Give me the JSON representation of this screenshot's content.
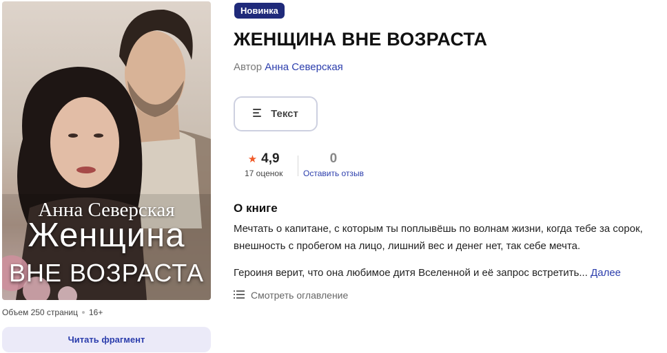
{
  "cover": {
    "author_text": "Анна Северская",
    "title_line1": "Женщина",
    "title_line2": "ВНЕ ВОЗРАСТА"
  },
  "meta": {
    "volume": "Объем 250 страниц",
    "age": "16+"
  },
  "read_fragment_label": "Читать фрагмент",
  "badge_label": "Новинка",
  "book_title": "ЖЕНЩИНА ВНЕ ВОЗРАСТА",
  "author": {
    "prefix": "Автор",
    "name": "Анна Северская"
  },
  "format": {
    "label": "Текст",
    "icon": "text-lines-icon"
  },
  "rating": {
    "value": "4,9",
    "count_label": "17 оценок",
    "icon": "star-icon"
  },
  "reviews": {
    "count": "0",
    "link_label": "Оставить отзыв"
  },
  "about": {
    "heading": "О книге",
    "paragraph1": "Мечтать о капитане, с которым ты поплывёшь по волнам жизни, когда тебе за сорок, внешность с пробегом на лицо, лишний вес и денег нет, так себе мечта.",
    "paragraph2": "Героиня верит, что она любимое дитя Вселенной и её запрос встретить...",
    "more_label": "Далее"
  },
  "toc_label": "Смотреть оглавление",
  "colors": {
    "accent": "#2b3dac",
    "badge_bg": "#1f2a7a",
    "star": "#f05a28",
    "read_button_bg": "#ebeaf8"
  }
}
